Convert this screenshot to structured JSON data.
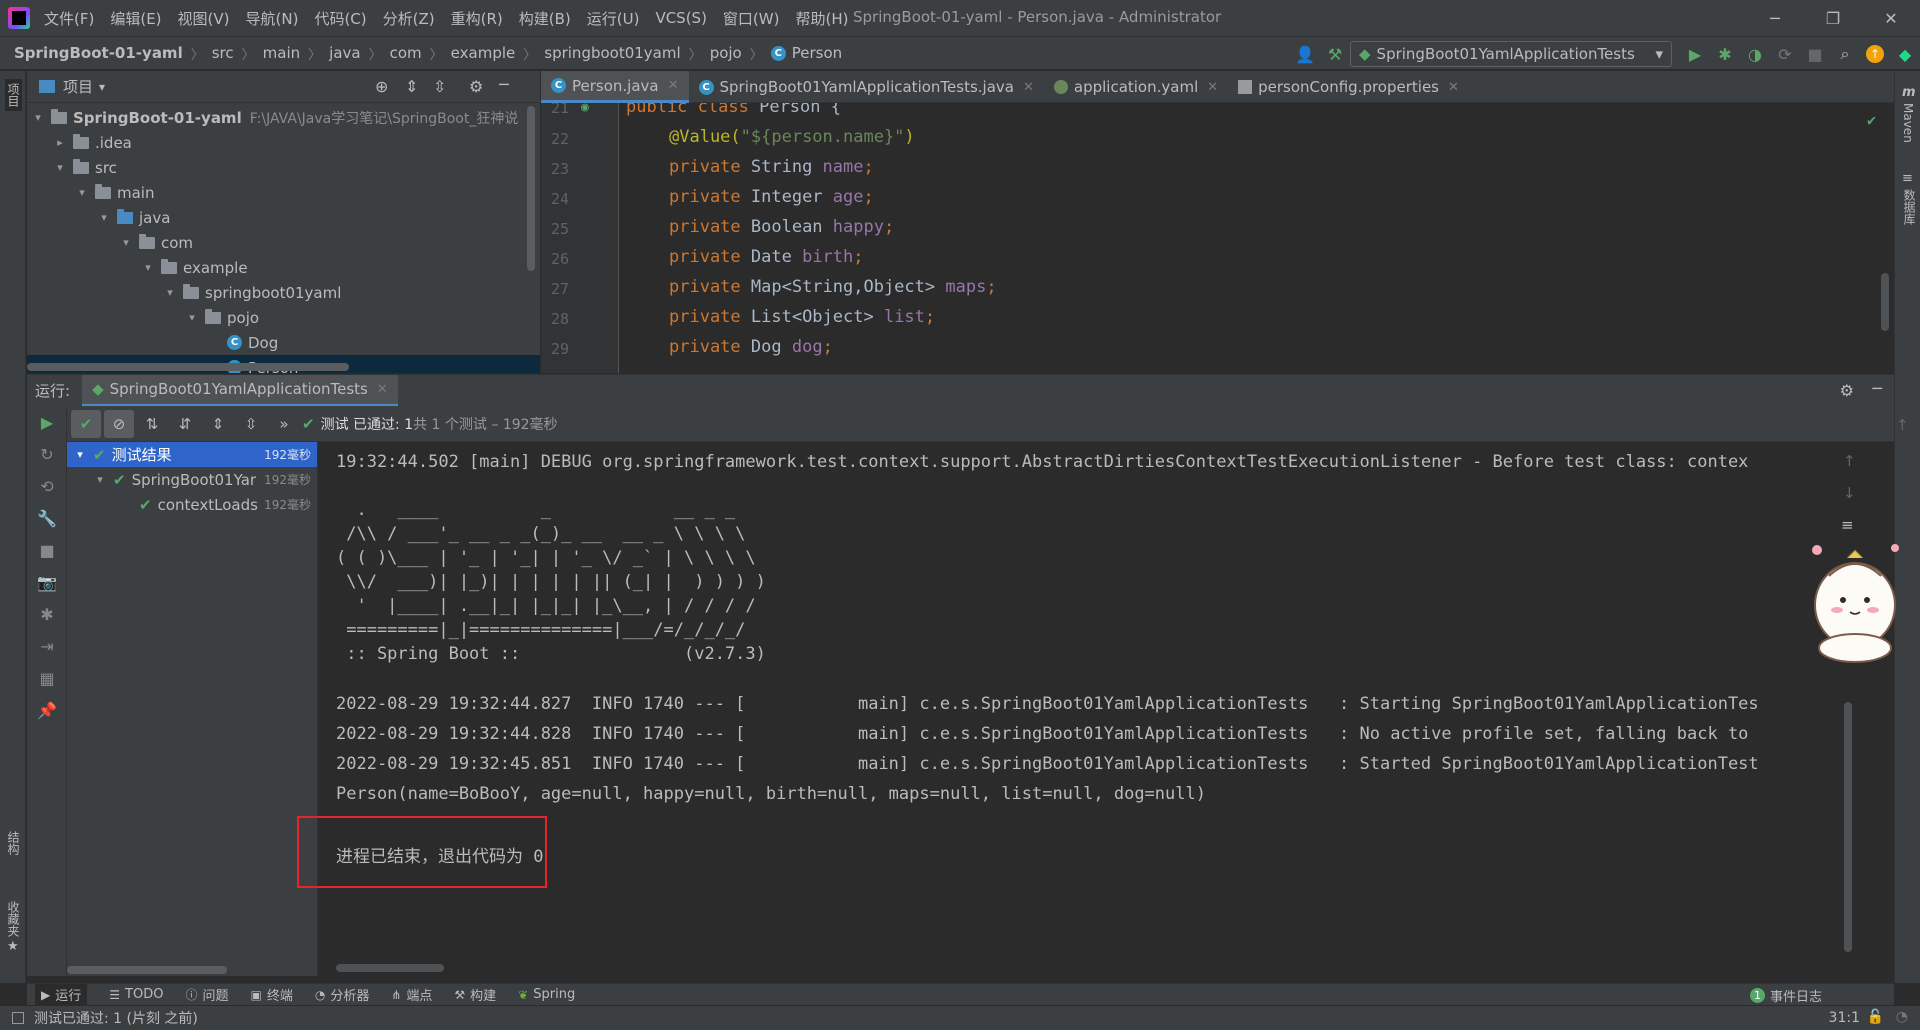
{
  "menu": [
    "文件(F)",
    "编辑(E)",
    "视图(V)",
    "导航(N)",
    "代码(C)",
    "分析(Z)",
    "重构(R)",
    "构建(B)",
    "运行(U)",
    "VCS(S)",
    "窗口(W)",
    "帮助(H)"
  ],
  "window_title": "SpringBoot-01-yaml - Person.java - Administrator",
  "breadcrumbs": [
    "SpringBoot-01-yaml",
    "src",
    "main",
    "java",
    "com",
    "example",
    "springboot01yaml",
    "pojo",
    "Person"
  ],
  "run_config": "SpringBoot01YamlApplicationTests",
  "left_stripe": {
    "project": "项目",
    "structure": "结构",
    "favorites": "收藏夹"
  },
  "right_stripe": {
    "maven": "Maven",
    "database": "数据库"
  },
  "project": {
    "header": "项目",
    "tree": [
      {
        "label": "SpringBoot-01-yaml",
        "path": "F:\\JAVA\\Java学习笔记\\SpringBoot_狂神说"
      },
      {
        "label": ".idea"
      },
      {
        "label": "src"
      },
      {
        "label": "main"
      },
      {
        "label": "java"
      },
      {
        "label": "com"
      },
      {
        "label": "example"
      },
      {
        "label": "springboot01yaml"
      },
      {
        "label": "pojo"
      },
      {
        "label": "Dog"
      },
      {
        "label": "Person"
      }
    ]
  },
  "editor_tabs": [
    {
      "label": "Person.java"
    },
    {
      "label": "SpringBoot01YamlApplicationTests.java"
    },
    {
      "label": "application.yaml"
    },
    {
      "label": "personConfig.properties"
    }
  ],
  "code": {
    "line_numbers": [
      "21",
      "22",
      "23",
      "24",
      "25",
      "26",
      "27",
      "28",
      "29"
    ],
    "lines": {
      "l21": {
        "kw1": "public",
        "kw2": "class",
        "rest": " Person {"
      },
      "l22": {
        "ann": "@Value(",
        "str": "\"${person.name}\"",
        "rest": ")"
      },
      "l23": {
        "kw": "private",
        "type": " String ",
        "fld": "name",
        "end": ";"
      },
      "l24": {
        "kw": "private",
        "type": " Integer ",
        "fld": "age",
        "end": ";"
      },
      "l25": {
        "kw": "private",
        "type": " Boolean ",
        "fld": "happy",
        "end": ";"
      },
      "l26": {
        "kw": "private",
        "type": " Date ",
        "fld": "birth",
        "end": ";"
      },
      "l27": {
        "kw": "private",
        "type": " Map<String,Object> ",
        "fld": "maps",
        "end": ";"
      },
      "l28": {
        "kw": "private",
        "type": " List<Object> ",
        "fld": "list",
        "end": ";"
      },
      "l29": {
        "kw": "private",
        "type": " Dog ",
        "fld": "dog",
        "end": ";"
      }
    }
  },
  "run": {
    "label": "运行:",
    "tab": "SpringBoot01YamlApplicationTests",
    "status_prefix": "测试 已通过: 1",
    "status_suffix": "共 1 个测试 – 192毫秒",
    "tests": [
      {
        "label": "测试结果",
        "time": "192毫秒"
      },
      {
        "label": "SpringBoot01Yar",
        "time": "192毫秒"
      },
      {
        "label": "contextLoads",
        "time": "192毫秒"
      }
    ],
    "console": [
      "19:32:44.502 [main] DEBUG org.springframework.test.context.support.AbstractDirtiesContextTestExecutionListener - Before test class: contex",
      "",
      "  .   ____          _            __ _ _",
      " /\\\\ / ___'_ __ _ _(_)_ __  __ _ \\ \\ \\ \\",
      "( ( )\\___ | '_ | '_| | '_ \\/ _` | \\ \\ \\ \\",
      " \\\\/  ___)| |_)| | | | | || (_| |  ) ) ) )",
      "  '  |____| .__|_| |_|_| |_\\__, | / / / /",
      " =========|_|==============|___/=/_/_/_/",
      " :: Spring Boot ::                (v2.7.3)",
      "",
      "2022-08-29 19:32:44.827  INFO 1740 --- [           main] c.e.s.SpringBoot01YamlApplicationTests   : Starting SpringBoot01YamlApplicationTes",
      "2022-08-29 19:32:44.828  INFO 1740 --- [           main] c.e.s.SpringBoot01YamlApplicationTests   : No active profile set, falling back to",
      "2022-08-29 19:32:45.851  INFO 1740 --- [           main] c.e.s.SpringBoot01YamlApplicationTests   : Started SpringBoot01YamlApplicationTest",
      "Person(name=BoBooY, age=null, happy=null, birth=null, maps=null, list=null, dog=null)",
      "",
      "进程已结束，退出代码为 0"
    ]
  },
  "bottom_tools": [
    "运行",
    "TODO",
    "问题",
    "终端",
    "分析器",
    "端点",
    "构建",
    "Spring"
  ],
  "event_log": "事件日志",
  "event_count": "1",
  "status": {
    "message": "测试已通过: 1 (片刻 之前)",
    "position": "31:1"
  },
  "colors": {
    "accent": "#4a88c7",
    "pass": "#59a869",
    "highlight_box": "#e3262c"
  }
}
